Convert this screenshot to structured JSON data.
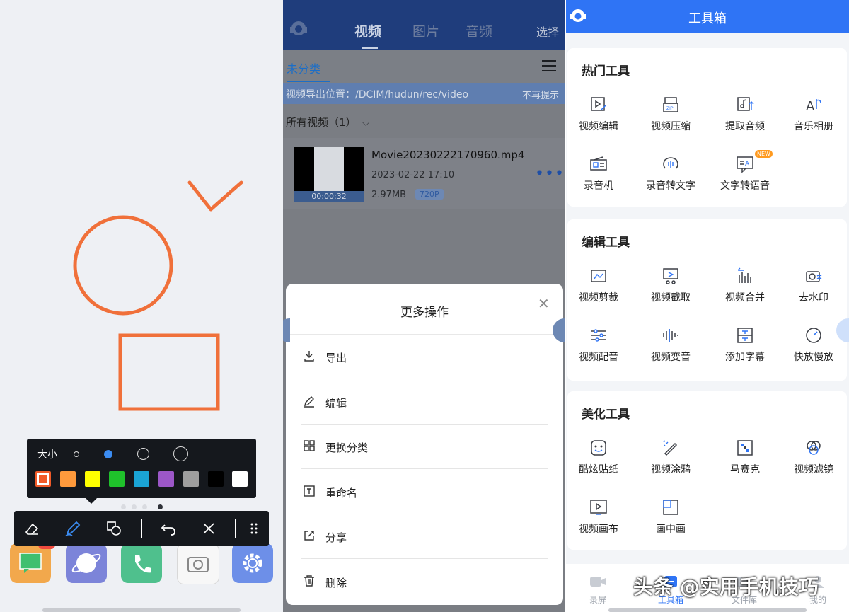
{
  "drawing": {
    "stroke_color": "#f0703a",
    "size_label": "大小",
    "swatches": [
      "#f05a28",
      "#ff9a3c",
      "#ffff00",
      "#1fc12b",
      "#1aa4d6",
      "#9c57c8",
      "#9e9e9e",
      "#000000",
      "#ffffff"
    ],
    "tools": [
      "eraser-icon",
      "pen-icon",
      "shapes-icon",
      "undo-icon",
      "close-icon",
      "grip-icon"
    ],
    "dock_badge": "",
    "dock_apps": [
      "messages-app",
      "browser-app",
      "phone-app",
      "camera-app",
      "settings-app"
    ]
  },
  "library": {
    "tabs": [
      "视频",
      "图片",
      "音频"
    ],
    "select_label": "选择",
    "category": "未分类",
    "export_path": "视频导出位置：/DCIM/hudun/rec/video",
    "dismiss": "不再提示",
    "all_videos": "所有视频（1）",
    "video": {
      "filename": "Movie20230222170960.mp4",
      "date": "2023-02-22  17:10",
      "size": "2.97MB",
      "resolution": "720P",
      "duration": "00:00:32"
    },
    "sheet": {
      "title": "更多操作",
      "actions": [
        {
          "label": "导出",
          "icon": "export-icon"
        },
        {
          "label": "编辑",
          "icon": "edit-icon"
        },
        {
          "label": "更换分类",
          "icon": "category-icon"
        },
        {
          "label": "重命名",
          "icon": "rename-icon"
        },
        {
          "label": "分享",
          "icon": "share-icon"
        },
        {
          "label": "删除",
          "icon": "delete-icon"
        }
      ]
    }
  },
  "toolbox": {
    "title": "工具箱",
    "sections": [
      {
        "title": "热门工具",
        "items": [
          {
            "label": "视频编辑",
            "icon": "video-edit-icon"
          },
          {
            "label": "视频压缩",
            "icon": "zip-icon"
          },
          {
            "label": "提取音频",
            "icon": "extract-audio-icon"
          },
          {
            "label": "音乐相册",
            "icon": "music-album-icon"
          },
          {
            "label": "录音机",
            "icon": "recorder-icon"
          },
          {
            "label": "录音转文字",
            "icon": "speech-to-text-icon"
          },
          {
            "label": "文字转语音",
            "icon": "text-to-speech-icon",
            "badge": "NEW"
          }
        ]
      },
      {
        "title": "编辑工具",
        "items": [
          {
            "label": "视频剪裁",
            "icon": "crop-icon"
          },
          {
            "label": "视频截取",
            "icon": "cut-icon"
          },
          {
            "label": "视频合并",
            "icon": "merge-icon"
          },
          {
            "label": "去水印",
            "icon": "remove-watermark-icon"
          },
          {
            "label": "视频配音",
            "icon": "dub-icon"
          },
          {
            "label": "视频变音",
            "icon": "voice-change-icon"
          },
          {
            "label": "添加字幕",
            "icon": "subtitle-icon"
          },
          {
            "label": "快放慢放",
            "icon": "speed-icon"
          }
        ]
      },
      {
        "title": "美化工具",
        "items": [
          {
            "label": "酷炫贴纸",
            "icon": "sticker-icon"
          },
          {
            "label": "视频涂鸦",
            "icon": "doodle-icon"
          },
          {
            "label": "马赛克",
            "icon": "mosaic-icon"
          },
          {
            "label": "视频滤镜",
            "icon": "filter-icon"
          },
          {
            "label": "视频画布",
            "icon": "canvas-icon"
          },
          {
            "label": "画中画",
            "icon": "pip-icon"
          }
        ]
      }
    ],
    "nav": [
      {
        "label": "录屏",
        "icon": "record-icon"
      },
      {
        "label": "工具箱",
        "icon": "toolbox-icon"
      },
      {
        "label": "文件库",
        "icon": "library-icon"
      },
      {
        "label": "我的",
        "icon": "profile-icon"
      }
    ],
    "watermark": "头条 @实用手机技巧"
  }
}
